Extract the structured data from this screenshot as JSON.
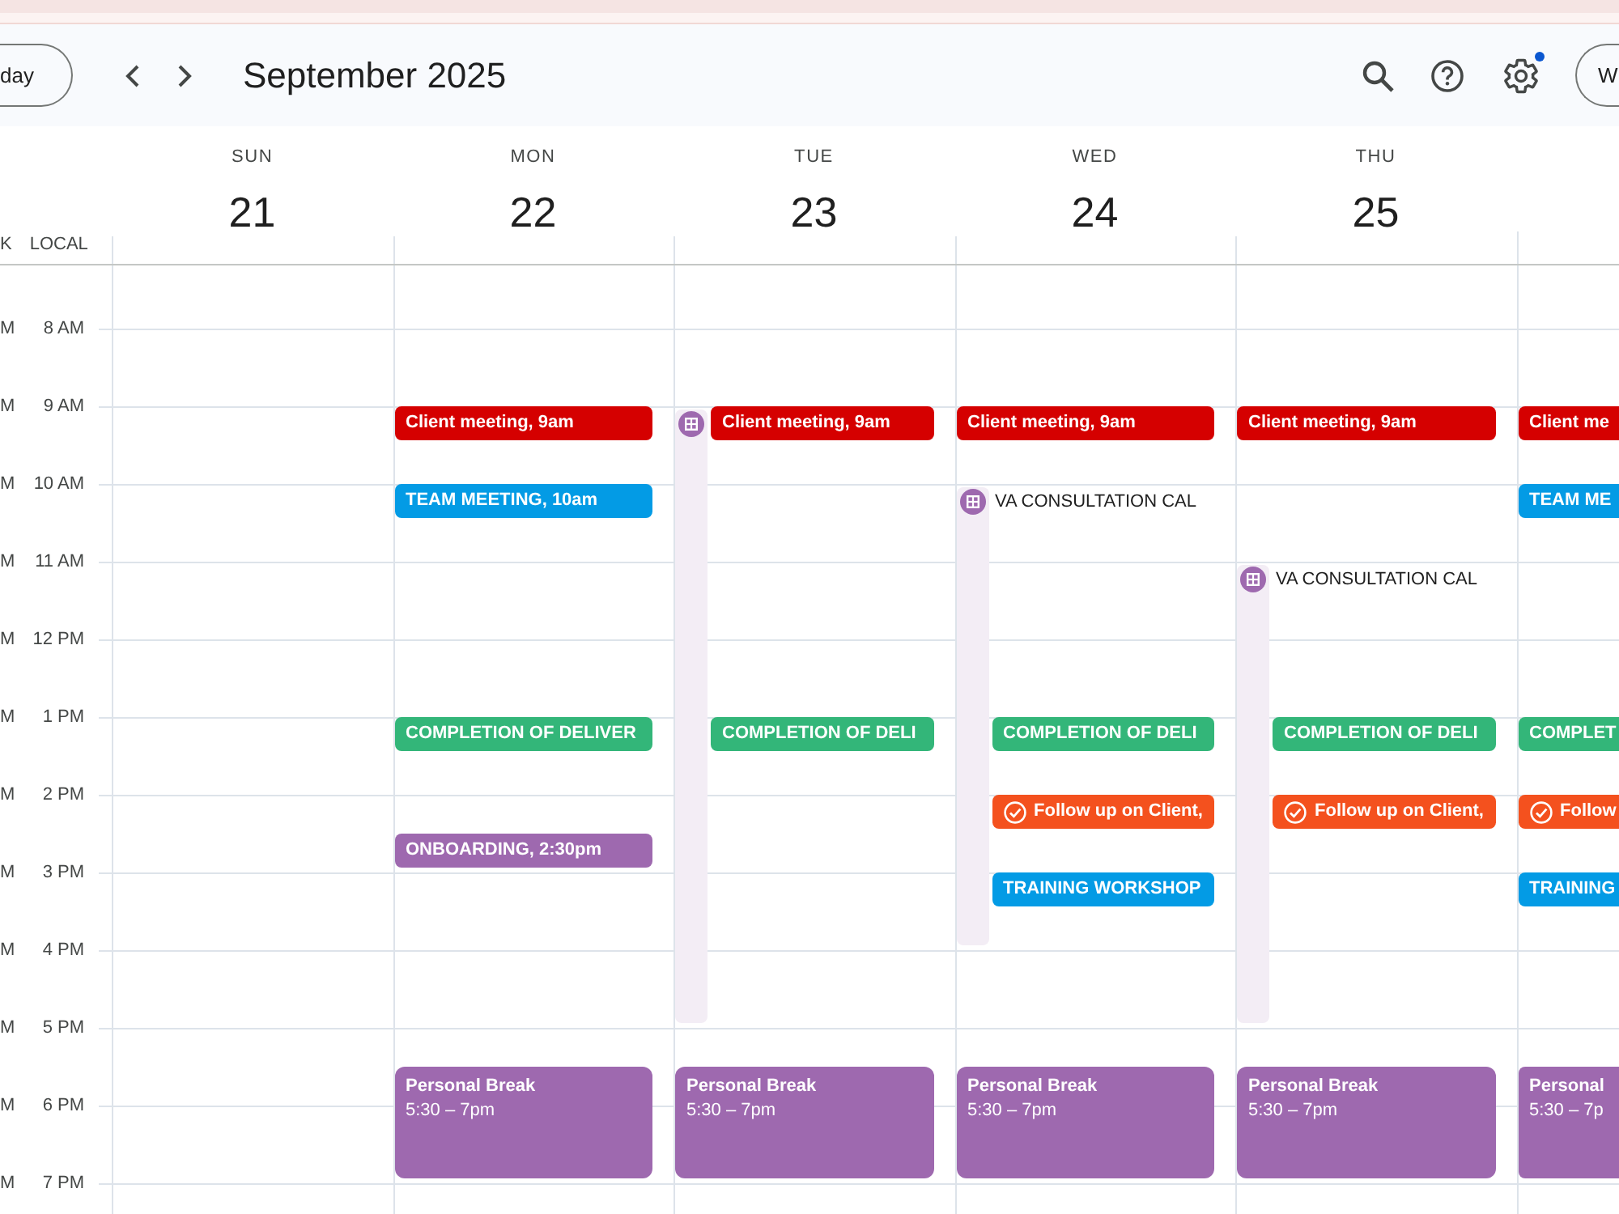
{
  "toolbar": {
    "today_button": "day",
    "title": "September 2025",
    "settings_notification": true,
    "view_button": "W"
  },
  "gutter": {
    "secondary_zone": "K",
    "primary_zone": "LOCAL"
  },
  "hours": [
    {
      "secondary": "M",
      "primary": "8 AM"
    },
    {
      "secondary": "M",
      "primary": "9 AM"
    },
    {
      "secondary": "M",
      "primary": "10 AM"
    },
    {
      "secondary": "M",
      "primary": "11 AM"
    },
    {
      "secondary": "M",
      "primary": "12 PM"
    },
    {
      "secondary": "M",
      "primary": "1 PM"
    },
    {
      "secondary": "M",
      "primary": "2 PM"
    },
    {
      "secondary": "M",
      "primary": "3 PM"
    },
    {
      "secondary": "M",
      "primary": "4 PM"
    },
    {
      "secondary": "M",
      "primary": "5 PM"
    },
    {
      "secondary": "M",
      "primary": "6 PM"
    },
    {
      "secondary": "M",
      "primary": "7 PM"
    }
  ],
  "days": [
    {
      "weekday": "SUN",
      "date": "21"
    },
    {
      "weekday": "MON",
      "date": "22",
      "events": [
        {
          "kind": "chip",
          "title": "Client meeting, 9am",
          "color": "#d50000"
        },
        {
          "kind": "chip",
          "title": "TEAM MEETING, 10am",
          "color": "#039be5"
        },
        {
          "kind": "chip",
          "title": "COMPLETION OF DELIVER",
          "color": "#33b679"
        },
        {
          "kind": "chip",
          "title": "ONBOARDING, 2:30pm",
          "color": "#9e69af"
        },
        {
          "kind": "block",
          "title": "Personal Break",
          "time": "5:30 – 7pm",
          "color": "#9e69af"
        }
      ]
    },
    {
      "weekday": "TUE",
      "date": "23",
      "events": [
        {
          "kind": "schedule",
          "color": "#9e69af"
        },
        {
          "kind": "chip",
          "title": "Client meeting, 9am",
          "color": "#d50000"
        },
        {
          "kind": "chip",
          "title": "COMPLETION OF DELI",
          "color": "#33b679"
        },
        {
          "kind": "block",
          "title": "Personal Break",
          "time": "5:30 – 7pm",
          "color": "#9e69af"
        }
      ]
    },
    {
      "weekday": "WED",
      "date": "24",
      "events": [
        {
          "kind": "chip",
          "title": "Client meeting, 9am",
          "color": "#d50000"
        },
        {
          "kind": "schedule",
          "title": "VA CONSULTATION CAL",
          "color": "#9e69af"
        },
        {
          "kind": "chip",
          "title": "COMPLETION OF DELI",
          "color": "#33b679"
        },
        {
          "kind": "task",
          "title": "Follow up on Client,",
          "color": "#f4511e"
        },
        {
          "kind": "chip",
          "title": "TRAINING WORKSHOP",
          "color": "#039be5"
        },
        {
          "kind": "block",
          "title": "Personal Break",
          "time": "5:30 – 7pm",
          "color": "#9e69af"
        }
      ]
    },
    {
      "weekday": "THU",
      "date": "25",
      "events": [
        {
          "kind": "chip",
          "title": "Client meeting, 9am",
          "color": "#d50000"
        },
        {
          "kind": "schedule",
          "title": "VA CONSULTATION CAL",
          "color": "#9e69af"
        },
        {
          "kind": "chip",
          "title": "COMPLETION OF DELI",
          "color": "#33b679"
        },
        {
          "kind": "task",
          "title": "Follow up on Client,",
          "color": "#f4511e"
        },
        {
          "kind": "block",
          "title": "Personal Break",
          "time": "5:30 – 7pm",
          "color": "#9e69af"
        }
      ]
    },
    {
      "events": [
        {
          "kind": "chip",
          "title": "Client me",
          "color": "#d50000"
        },
        {
          "kind": "chip",
          "title": "TEAM ME",
          "color": "#039be5"
        },
        {
          "kind": "chip",
          "title": "COMPLET",
          "color": "#33b679"
        },
        {
          "kind": "task",
          "title": "Follow",
          "color": "#f4511e"
        },
        {
          "kind": "chip",
          "title": "TRAINING",
          "color": "#039be5"
        },
        {
          "kind": "block",
          "title": "Personal",
          "time": "5:30 – 7p",
          "color": "#9e69af"
        }
      ]
    }
  ]
}
